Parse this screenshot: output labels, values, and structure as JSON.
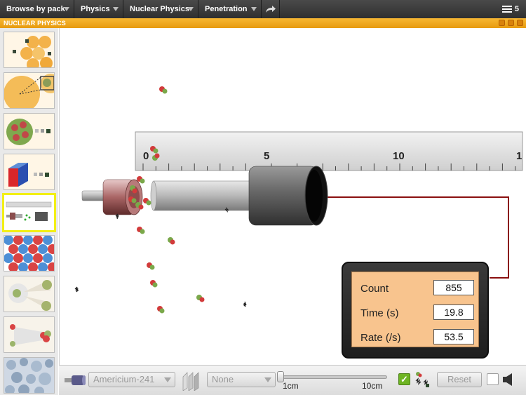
{
  "nav": {
    "browse_label": "Browse by pack",
    "subject_label": "Physics",
    "topic_label": "Nuclear Physics",
    "sim_label": "Penetration",
    "menu_count": "5"
  },
  "window": {
    "title": "NUCLEAR PHYSICS"
  },
  "sidebar": {
    "items": [
      {
        "name": "nucleus-thumb"
      },
      {
        "name": "zoom-nucleus-thumb"
      },
      {
        "name": "decay-nucleus-thumb"
      },
      {
        "name": "absorber-block-thumb"
      },
      {
        "name": "penetration-thumb",
        "active": true
      },
      {
        "name": "lattice-thumb"
      },
      {
        "name": "scattering-thumb"
      },
      {
        "name": "beam-thumb"
      },
      {
        "name": "cloud-chamber-thumb"
      }
    ]
  },
  "ruler": {
    "tick_labels": [
      "0",
      "5",
      "10",
      "1"
    ]
  },
  "counter": {
    "count_label": "Count",
    "count_value": "855",
    "time_label": "Time (s)",
    "time_value": "19.8",
    "rate_label": "Rate (/s)",
    "rate_value": "53.5"
  },
  "toolbar": {
    "source_selected": "Americium-241",
    "absorber_selected": "None",
    "distance_min": "1cm",
    "distance_max": "10cm",
    "distance_fraction": 0.0,
    "show_particles_checked": true,
    "reset_label": "Reset",
    "sound_checked": false
  },
  "colors": {
    "accent_orange": "#f2a81d",
    "selection_yellow": "#f2ef15",
    "counter_face": "#f8c48e",
    "cable_red": "#8a0f0f",
    "check_green": "#6eb423"
  }
}
